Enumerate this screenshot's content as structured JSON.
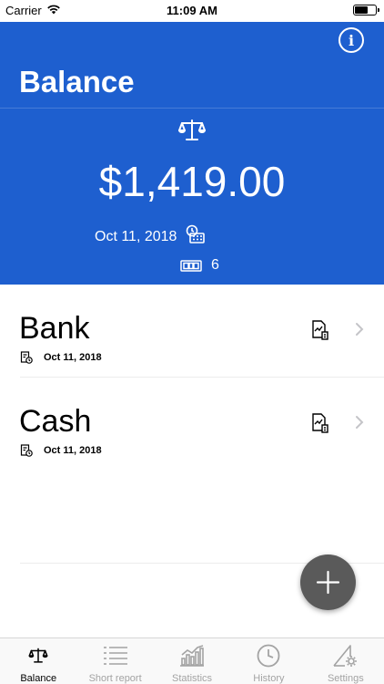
{
  "status_bar": {
    "carrier": "Carrier",
    "time": "11:09 AM"
  },
  "header": {
    "title": "Balance",
    "amount": "$1,419.00",
    "date": "Oct 11, 2018",
    "count": "6"
  },
  "accounts": [
    {
      "name": "Bank",
      "date": "Oct 11, 2018"
    },
    {
      "name": "Cash",
      "date": "Oct 11, 2018"
    }
  ],
  "tabs": [
    {
      "label": "Balance",
      "icon": "scale-icon",
      "active": true
    },
    {
      "label": "Short report",
      "icon": "list-icon",
      "active": false
    },
    {
      "label": "Statistics",
      "icon": "bar-chart-icon",
      "active": false
    },
    {
      "label": "History",
      "icon": "clock-icon",
      "active": false
    },
    {
      "label": "Settings",
      "icon": "settings-icon",
      "active": false
    }
  ],
  "colors": {
    "header_bg": "#1e5fcf",
    "fab_bg": "#5a5a5a",
    "tab_inactive": "#a3a3a3",
    "tab_active": "#000000"
  }
}
